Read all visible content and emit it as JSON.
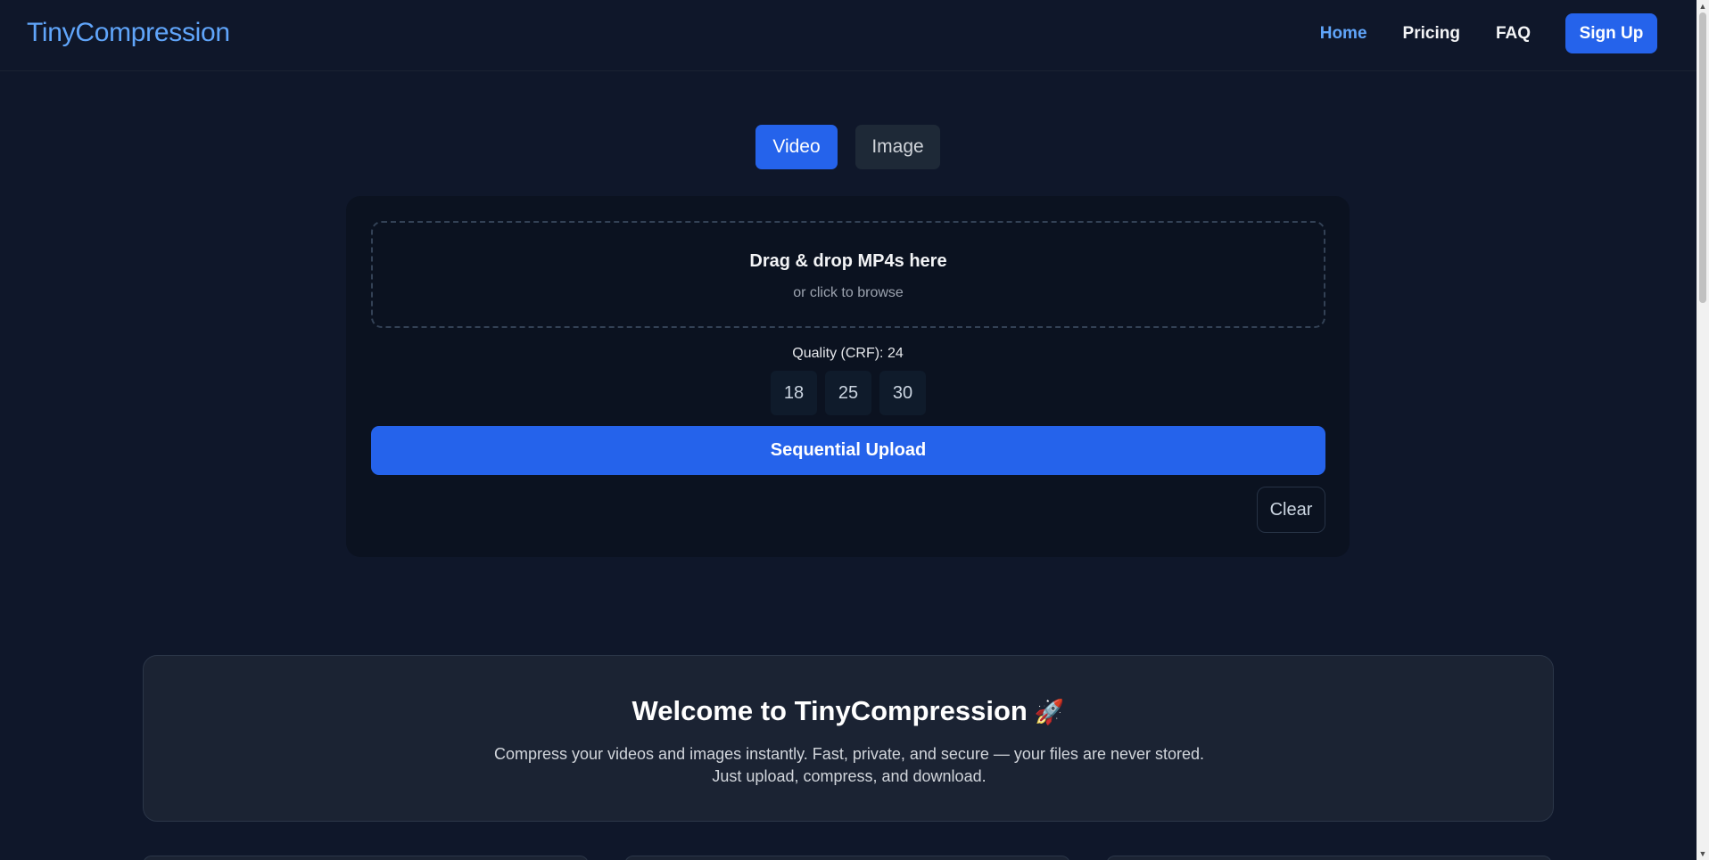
{
  "header": {
    "logo": "TinyCompression",
    "nav": [
      {
        "label": "Home",
        "active": true
      },
      {
        "label": "Pricing",
        "active": false
      },
      {
        "label": "FAQ",
        "active": false
      }
    ],
    "signup_label": "Sign Up"
  },
  "tabs": [
    {
      "label": "Video",
      "active": true
    },
    {
      "label": "Image",
      "active": false
    }
  ],
  "uploader": {
    "dropzone_title": "Drag & drop MP4s here",
    "dropzone_subtitle": "or click to browse",
    "quality_label": "Quality (CRF): 24",
    "crf_options": [
      "18",
      "25",
      "30"
    ],
    "upload_label": "Sequential Upload",
    "clear_label": "Clear"
  },
  "welcome": {
    "title": "Welcome to TinyCompression",
    "emoji": "🚀",
    "text": "Compress your videos and images instantly. Fast, private, and secure — your files are never stored. Just upload, compress, and download."
  },
  "colors": {
    "background": "#0f172a",
    "accent": "#2563eb",
    "link_active": "#60a5fa"
  }
}
